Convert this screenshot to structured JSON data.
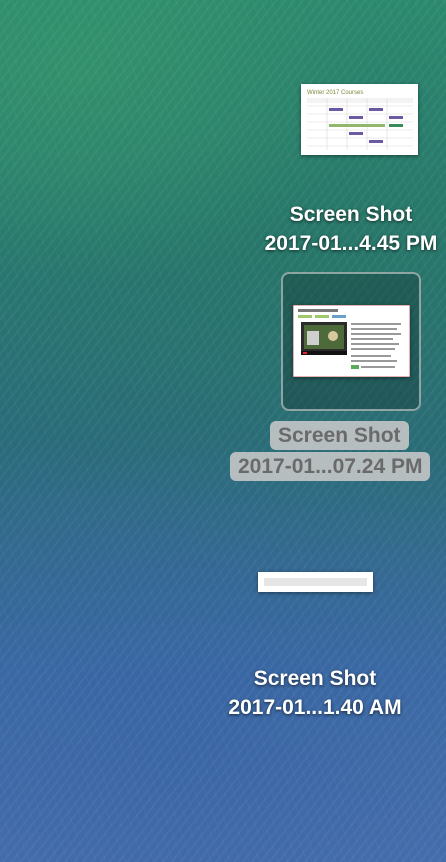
{
  "desktop": {
    "files": [
      {
        "name_line1": "Screen Shot",
        "name_line2": "2017-01...4.45 PM",
        "thumbnail": "Winter 2017 Courses",
        "selected": false
      },
      {
        "name_line1": "Screen Shot",
        "name_line2": "2017-01...07.24 PM",
        "thumbnail": "Computer technology lesson page with video",
        "selected": true
      },
      {
        "name_line1": "Screen Shot",
        "name_line2": "2017-01...1.40 AM",
        "thumbnail": "narrow blank strip",
        "selected": false
      }
    ],
    "thumb1_title": "Winter 2017 Courses",
    "colors": {
      "label_text": "#ffffff",
      "selected_label_bg": "#c8c8c8",
      "selected_label_text": "#6a6a6a"
    }
  }
}
